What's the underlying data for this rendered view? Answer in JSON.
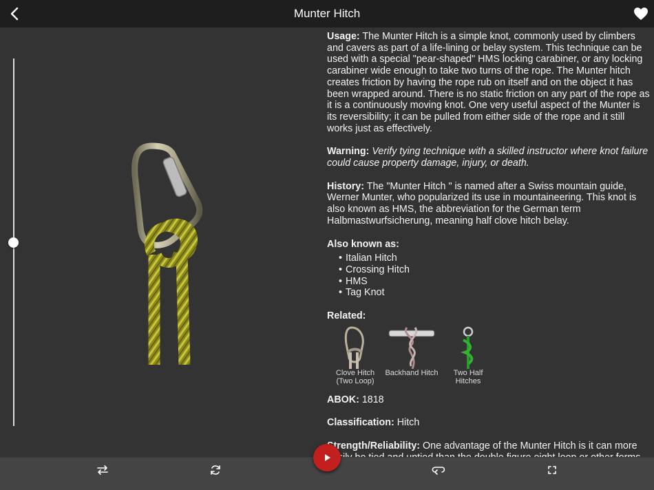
{
  "nav": {
    "title": "Munter Hitch",
    "back_icon": "chevron-left-icon",
    "favorite_icon": "heart-icon"
  },
  "viewer": {
    "speed_slider_fraction": 0.5
  },
  "info": {
    "usage_label": "Usage:",
    "usage_text": " The Munter Hitch is a simple knot, commonly used by climbers and cavers as part of a life-lining or belay system.  This technique can be used with a special \"pear-shaped\" HMS locking carabiner, or any locking carabiner wide enough to take two turns of the rope.  The Munter hitch creates friction by having the rope rub on itself and on the object it has been wrapped around. There is no static friction on any part of the rope as it is a continuously moving knot. One very useful aspect of the Munter is its reversibility; it can be pulled from either side of the rope and it still works just as effectively.",
    "warning_label": "Warning:",
    "warning_text": " Verify tying technique with a skilled instructor where knot failure could cause property damage, injury, or death.",
    "history_label": "History:",
    "history_text": " The \"Munter Hitch \" is named after a Swiss mountain guide, Werner Munter, who popularized its use in mountaineering.  This knot is also known as HMS, the abbreviation for the German term Halbmastwurfsicherung, meaning half clove hitch belay.",
    "aka_label": "Also known as:",
    "aka": [
      "Italian Hitch",
      "Crossing Hitch",
      "HMS",
      "Tag Knot"
    ],
    "related_label": "Related:",
    "related": [
      {
        "label": "Clove Hitch (Two Loop)"
      },
      {
        "label": "Backhand Hitch"
      },
      {
        "label": "Two Half Hitches"
      }
    ],
    "abok_label": "ABOK:",
    "abok_value": " 1818",
    "class_label": "Classification:",
    "class_value": " Hitch",
    "strength_label": "Strength/Reliability:",
    "strength_text": " One advantage of the Munter Hitch is it can more easily be tied and untied than the double figure eight loop or other forms of"
  },
  "toolbar": {
    "buttons": [
      "swap-arrows-icon",
      "rotate-icon",
      "play-icon",
      "loop-icon",
      "fullscreen-icon"
    ]
  },
  "colors": {
    "play_button": "#c21f1f",
    "rope": "#8c8a1c",
    "rope_highlight": "#c9c63c",
    "background": "#333333",
    "navbar": "#1e1e1e"
  }
}
